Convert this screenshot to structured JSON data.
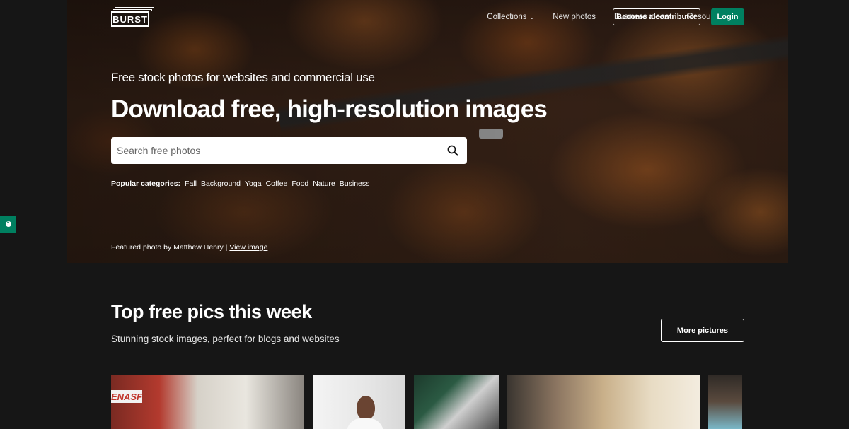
{
  "brand": {
    "logo_text": "BURST"
  },
  "nav": {
    "items": [
      {
        "label": "Collections",
        "has_dropdown": true
      },
      {
        "label": "New photos",
        "has_dropdown": false
      },
      {
        "label": "Business ideas",
        "has_dropdown": false
      },
      {
        "label": "Resources",
        "has_dropdown": true
      }
    ],
    "contribute_label": "Become a contributor",
    "login_label": "Login"
  },
  "hero": {
    "subtitle": "Free stock photos for websites and commercial use",
    "title": "Download free, high-resolution images",
    "search_placeholder": "Search free photos",
    "categories_label": "Popular categories:",
    "categories": [
      "Fall",
      "Background",
      "Yoga",
      "Coffee",
      "Food",
      "Nature",
      "Business"
    ],
    "credit_text": "Featured photo by Matthew Henry |",
    "credit_link": "View image"
  },
  "section": {
    "title": "Top free pics this week",
    "subtitle": "Stunning stock images, perfect for blogs and websites",
    "more_label": "More pictures"
  },
  "thumbnails": {
    "t1_sign_text": "ENASF"
  },
  "colors": {
    "accent": "#008060",
    "background": "#161616"
  }
}
